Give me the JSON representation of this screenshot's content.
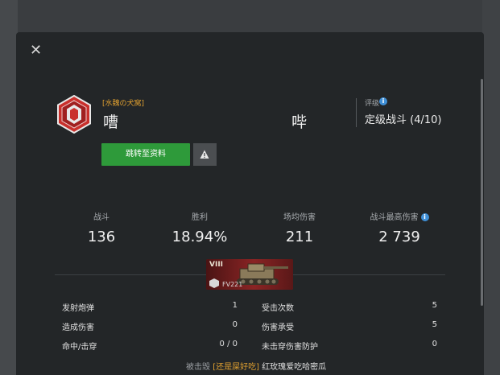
{
  "colors": {
    "accent_green": "#2e9a3a",
    "clan_tag": "#e0a030",
    "info_blue": "#3f8fd6"
  },
  "header": {
    "close_icon": "close-icon"
  },
  "player": {
    "clan_tag": "[水魏の犬窝]",
    "name": "嘈",
    "opponent": "哔"
  },
  "rating": {
    "label": "评级",
    "value": "定级战斗 (4/10)"
  },
  "actions": {
    "profile_button": "跳转至资料",
    "report_icon": "warning-icon"
  },
  "stats": [
    {
      "label": "战斗",
      "value": "136"
    },
    {
      "label": "胜利",
      "value": "18.94%"
    },
    {
      "label": "场均伤害",
      "value": "211"
    },
    {
      "label": "战斗最高伤害",
      "value": "2 739"
    }
  ],
  "tank": {
    "tier": "VIII",
    "name": "FV221"
  },
  "details_left": [
    {
      "label": "发射炮弹",
      "value": "1"
    },
    {
      "label": "造成伤害",
      "value": "0"
    },
    {
      "label": "命中/击穿",
      "value": "0 / 0"
    }
  ],
  "details_right": [
    {
      "label": "受击次数",
      "value": "5"
    },
    {
      "label": "伤害承受",
      "value": "5"
    },
    {
      "label": "未击穿伤害防护",
      "value": "0"
    }
  ],
  "destroyed": {
    "label": "被击毁",
    "tag": "[还是屎好吃]",
    "by": "红玫瑰爱吃哈密瓜"
  }
}
